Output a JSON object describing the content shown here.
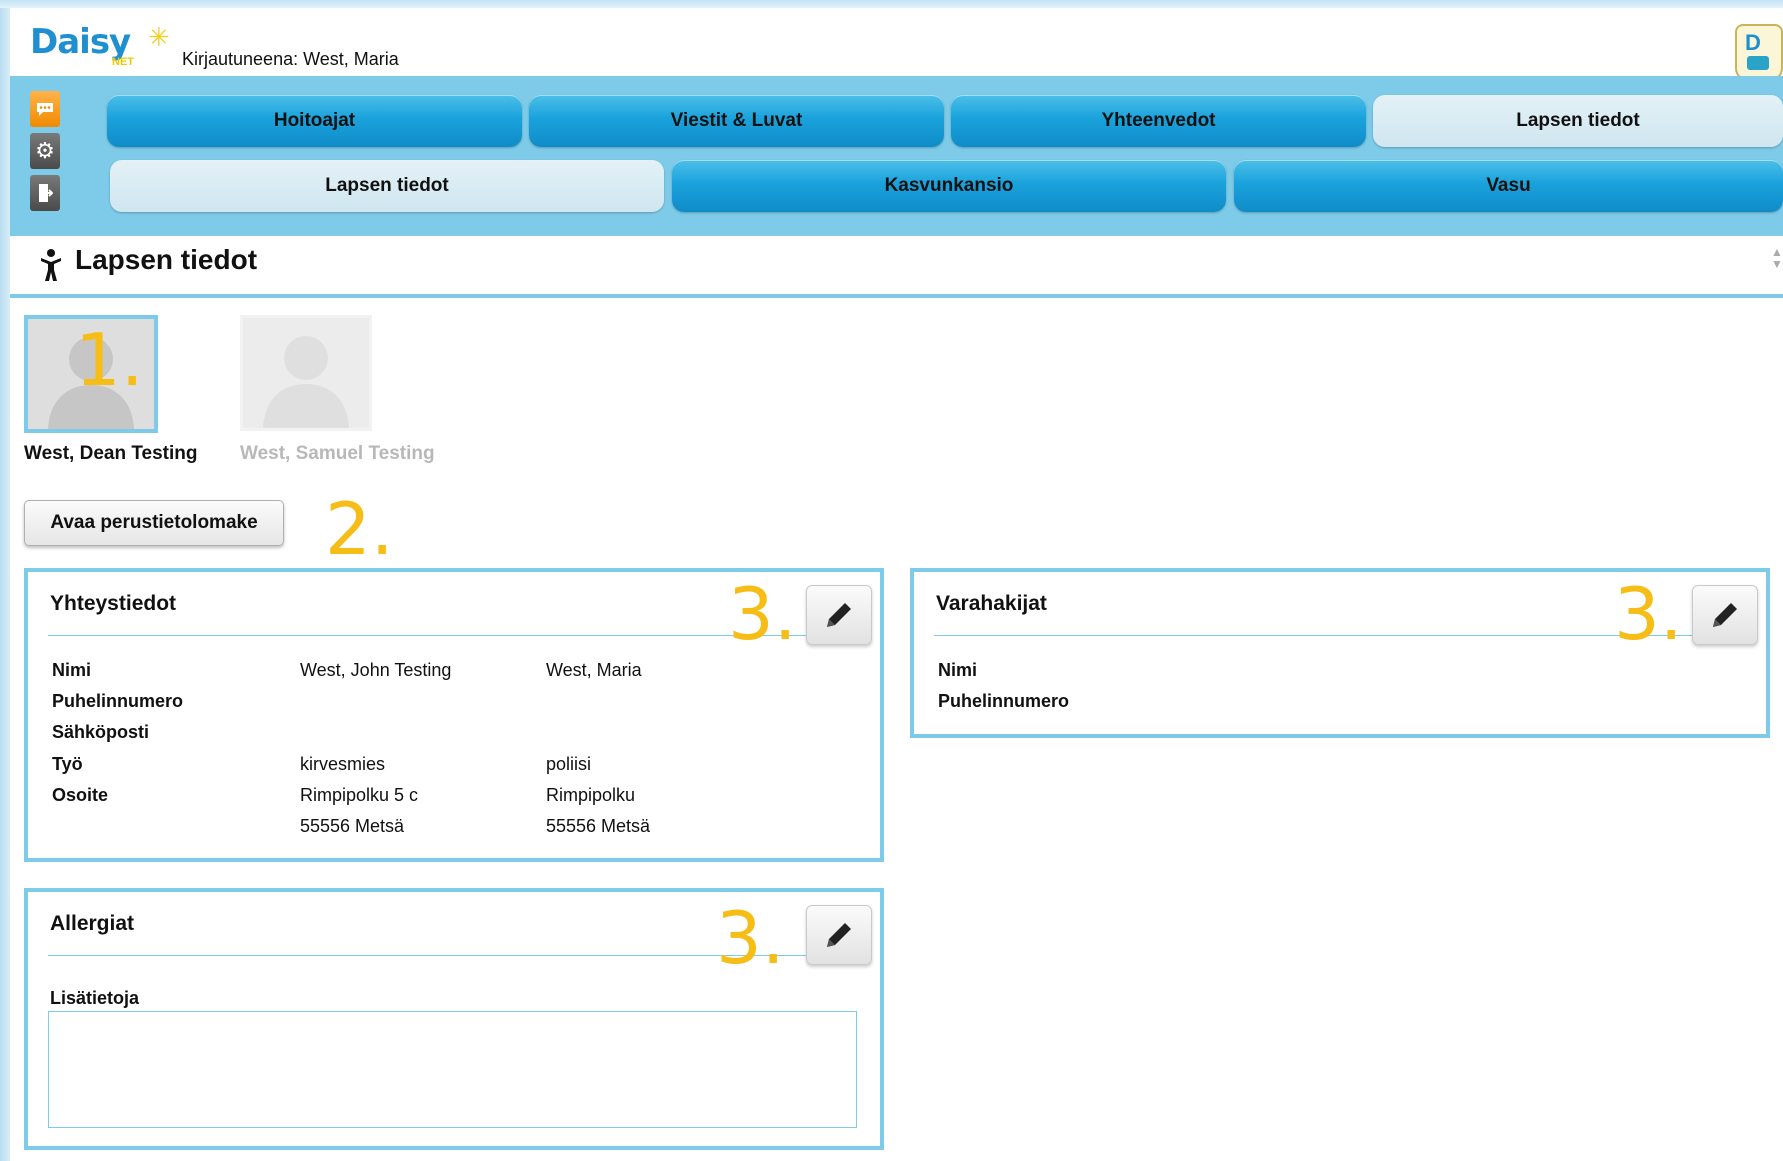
{
  "header": {
    "logo": "Daisy",
    "logo_sub": "NET",
    "logged_in": "Kirjautuneena: West, Maria"
  },
  "tabs_row1": [
    "Hoitoajat",
    "Viestit & Luvat",
    "Yhteenvedot",
    "Lapsen tiedot"
  ],
  "tabs_row2": [
    "Lapsen tiedot",
    "Kasvunkansio",
    "Vasu"
  ],
  "page_title": "Lapsen tiedot",
  "children": [
    {
      "name": "West, Dean Testing",
      "selected": true
    },
    {
      "name": "West, Samuel Testing",
      "selected": false
    }
  ],
  "open_form_button": "Avaa perustietolomake",
  "contact": {
    "title": "Yhteystiedot",
    "labels": [
      "Nimi",
      "Puhelinnumero",
      "Sähköposti",
      "Työ",
      "Osoite"
    ],
    "guardian1": {
      "name": "West, John Testing",
      "work": "kirvesmies",
      "address1": "Rimpipolku 5 c",
      "address2": "55556 Metsä"
    },
    "guardian2": {
      "name": "West, Maria",
      "work": "poliisi",
      "address1": "Rimpipolku",
      "address2": "55556 Metsä"
    }
  },
  "backup": {
    "title": "Varahakijat",
    "labels": [
      "Nimi",
      "Puhelinnumero"
    ]
  },
  "allergies": {
    "title": "Allergiat",
    "extra_label": "Lisätietoja",
    "extra_value": ""
  },
  "markers": {
    "one": "1.",
    "two": "2.",
    "three": "3."
  },
  "colors": {
    "accent": "#7dcbe9",
    "tab": "#1aa2dc",
    "marker": "#f6bd16"
  }
}
